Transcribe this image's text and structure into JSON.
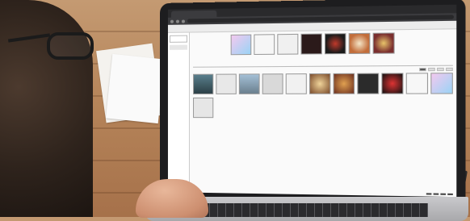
{
  "scene": {
    "description_hidden": ""
  },
  "laptop": {
    "browser": {
      "tab_label": "",
      "url": ""
    },
    "app": {
      "toolbar_items": [],
      "sidebar_items": [],
      "thumbnail_count_top": 7,
      "thumbnail_count_bottom": 12,
      "bottom_tabs": [
        "",
        "",
        "",
        ""
      ],
      "footer_buttons": [
        "",
        "",
        "",
        ""
      ]
    }
  },
  "colors": {
    "desk": "#b6855a",
    "laptop_bezel": "#1d1d1f",
    "screen_bg": "#f2f2f2"
  }
}
